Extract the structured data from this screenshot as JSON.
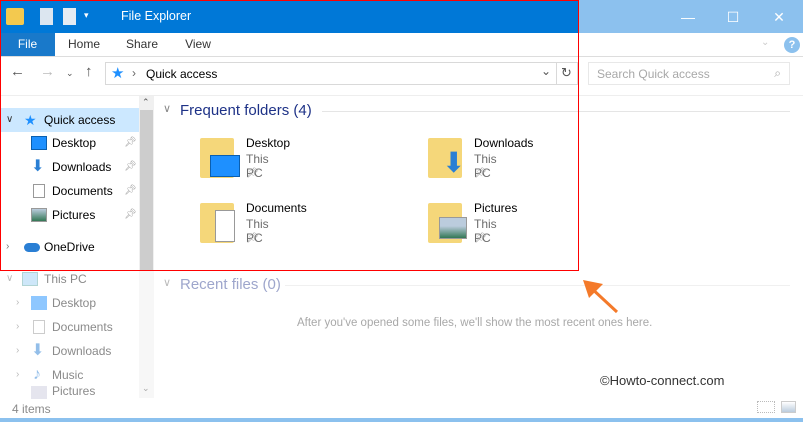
{
  "window": {
    "title": "File Explorer",
    "minimize": "—",
    "maximize": "☐",
    "close": "✕",
    "help": "?"
  },
  "ribbon": {
    "tabs": [
      "File",
      "Home",
      "Share",
      "View"
    ]
  },
  "address": {
    "path": "Quick access",
    "separator": "›",
    "search_placeholder": "Search Quick access"
  },
  "nav": {
    "quick_access": {
      "label": "Quick access",
      "items": [
        {
          "label": "Desktop",
          "icon": "desktop-icon"
        },
        {
          "label": "Downloads",
          "icon": "downloads-icon"
        },
        {
          "label": "Documents",
          "icon": "documents-icon"
        },
        {
          "label": "Pictures",
          "icon": "pictures-icon"
        }
      ]
    },
    "onedrive": "OneDrive",
    "this_pc": {
      "label": "This PC",
      "items": [
        {
          "label": "Desktop"
        },
        {
          "label": "Documents"
        },
        {
          "label": "Downloads"
        },
        {
          "label": "Music"
        },
        {
          "label": "Pictures"
        }
      ]
    }
  },
  "main": {
    "frequent_header": "Frequent folders (4)",
    "folders": [
      {
        "name": "Desktop",
        "location": "This PC"
      },
      {
        "name": "Downloads",
        "location": "This PC"
      },
      {
        "name": "Documents",
        "location": "This PC"
      },
      {
        "name": "Pictures",
        "location": "This PC"
      }
    ],
    "recent_header": "Recent files (0)",
    "recent_empty": "After you've opened some files, we'll show the most recent ones here."
  },
  "status": {
    "items": "4 items"
  },
  "watermark": "©Howto-connect.com",
  "colors": {
    "titlebar": "#0078d7",
    "accent": "#1e3287",
    "highlight": "#cce8ff",
    "annotation": "#ff0000",
    "arrow": "#f47a2a"
  }
}
